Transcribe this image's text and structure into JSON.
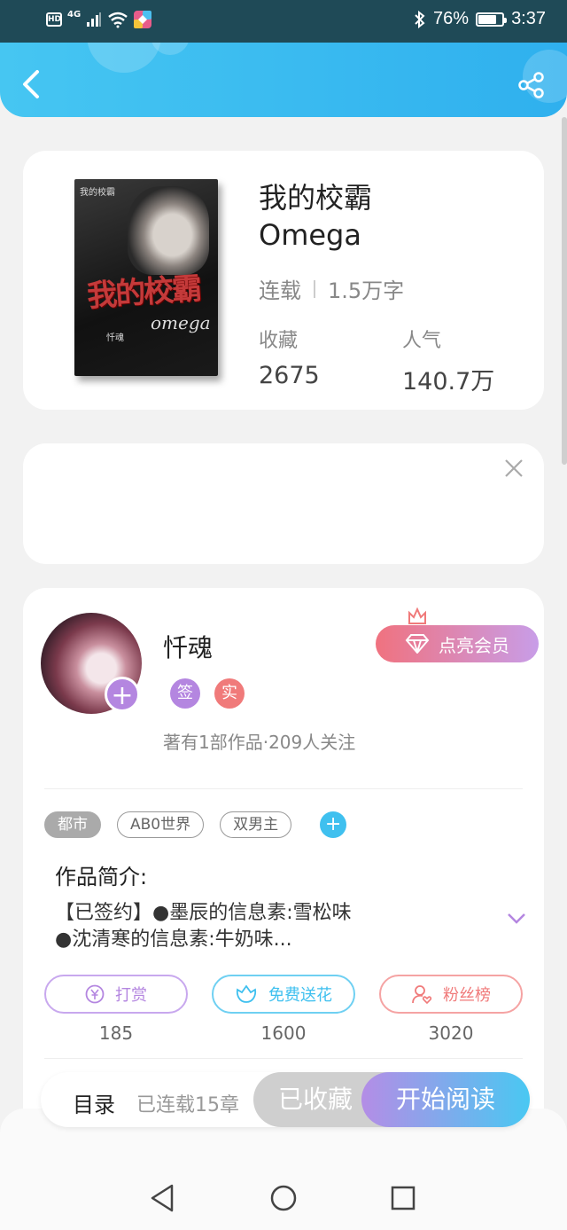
{
  "status_bar": {
    "network": "4G",
    "battery": "76%",
    "battery_level": 0.76,
    "time": "3:37"
  },
  "header": {
    "back_icon": "chevron-left-icon",
    "share_icon": "share-icon"
  },
  "book": {
    "title_line1": "我的校霸",
    "title_line2": "Omega",
    "status": "连载",
    "word_count": "1.5万字",
    "collect_label": "收藏",
    "collect_value": "2675",
    "popularity_label": "人气",
    "popularity_value": "140.7万",
    "cover_title": "我的校霸",
    "cover_subtitle": "omega",
    "cover_author": "忏魂"
  },
  "author": {
    "name": "忏魂",
    "badge_signed": "签",
    "badge_verified": "实",
    "stats": "著有1部作品·209人关注",
    "vip_button": "点亮会员"
  },
  "tags": [
    "都市",
    "AB0世界",
    "双男主"
  ],
  "intro": {
    "title": "作品简介:",
    "line1": "【已签约】●墨辰的信息素:雪松味",
    "line2": "●沈清寒的信息素:牛奶味..."
  },
  "actions": [
    {
      "label": "打赏",
      "count": "185",
      "color": "#b48de6",
      "icon": "yuan-icon"
    },
    {
      "label": "免费送花",
      "count": "1600",
      "color": "#3fc0ef",
      "icon": "flower-icon"
    },
    {
      "label": "粉丝榜",
      "count": "3020",
      "color": "#f07a7a",
      "icon": "fan-icon"
    }
  ],
  "bottom_bar": {
    "toc": "目录",
    "chapters": "已连载15章",
    "collected": "已收藏",
    "read": "开始阅读"
  }
}
